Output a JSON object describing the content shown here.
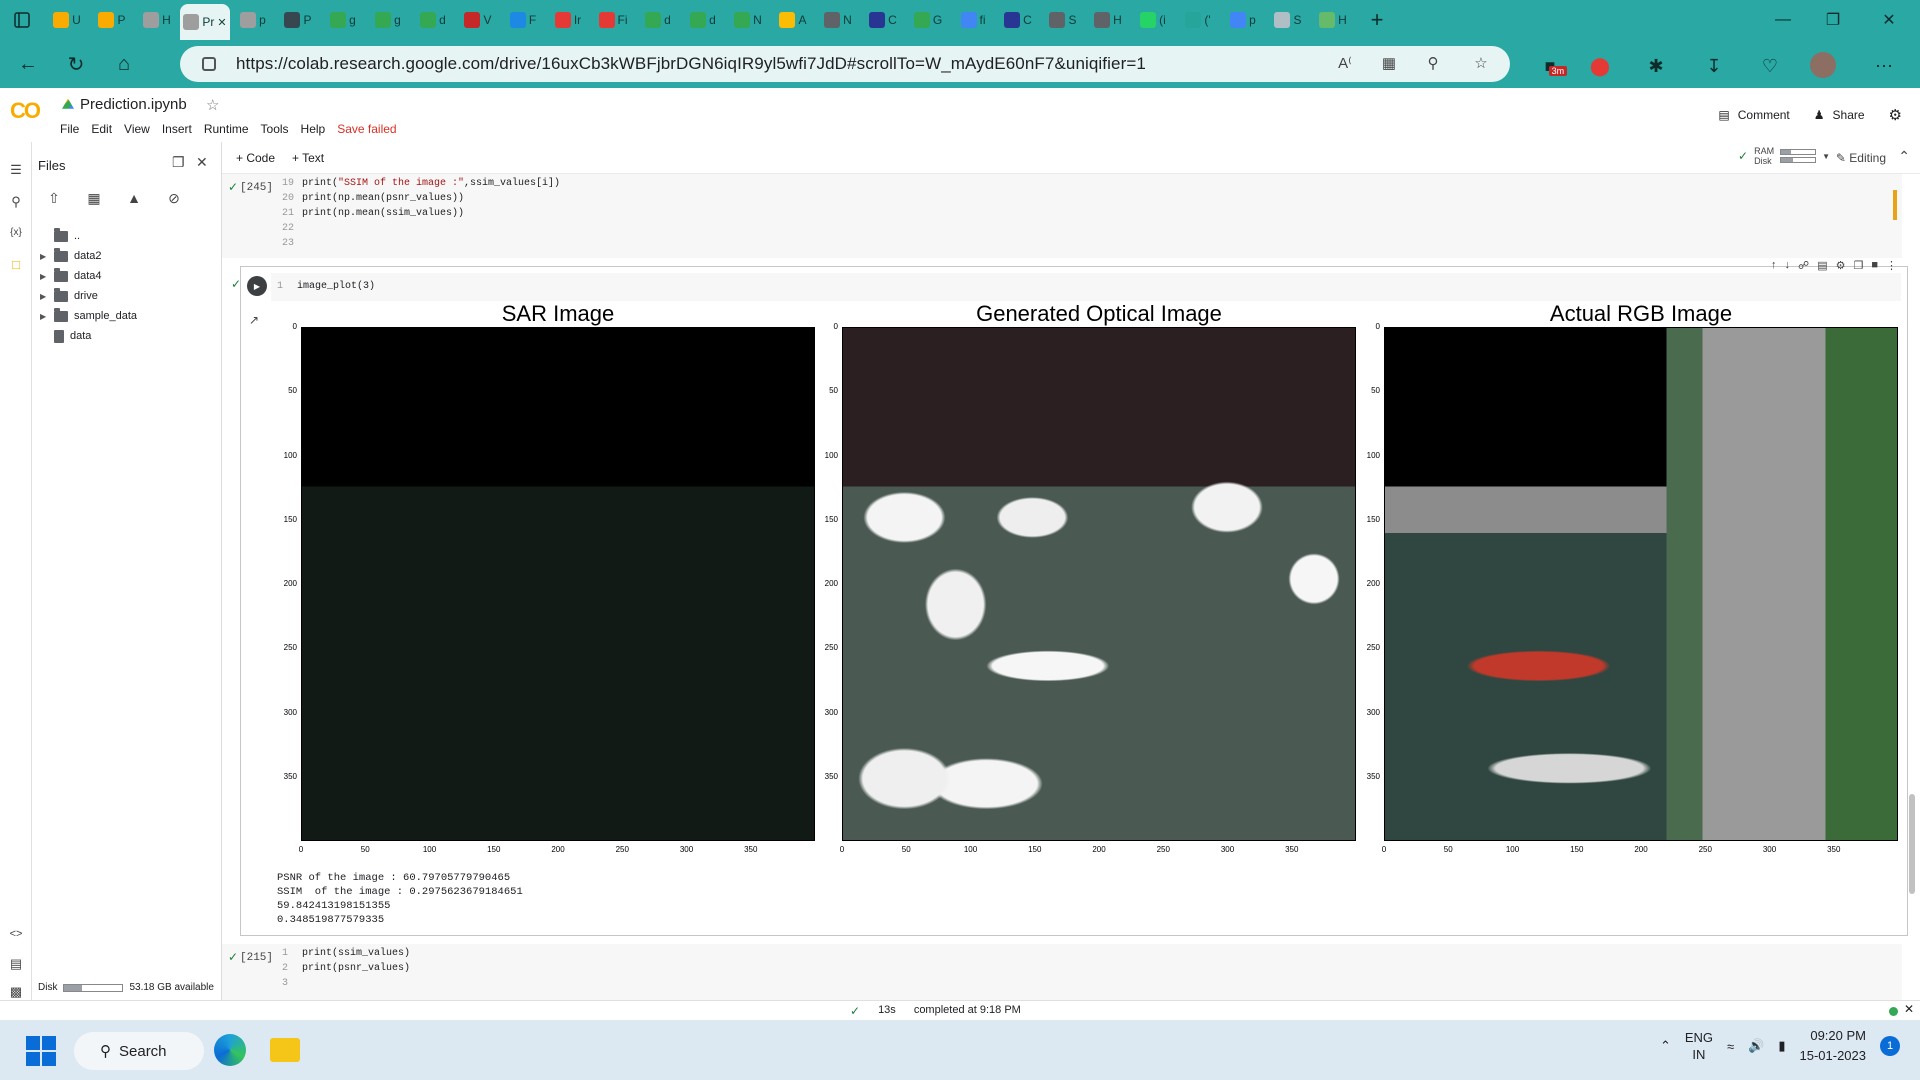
{
  "browser": {
    "tabs": [
      {
        "letter": "U",
        "color": "#f9ab00"
      },
      {
        "letter": "P",
        "color": "#f9ab00"
      },
      {
        "letter": "H",
        "color": "#9e9e9e"
      },
      {
        "letter": "Pr",
        "color": "#9e9e9e",
        "active": true
      },
      {
        "letter": "p",
        "color": "#9e9e9e"
      },
      {
        "letter": "P",
        "color": "#37474f"
      },
      {
        "letter": "g",
        "color": "#34a853"
      },
      {
        "letter": "g",
        "color": "#34a853"
      },
      {
        "letter": "d",
        "color": "#34a853"
      },
      {
        "letter": "V",
        "color": "#c62828"
      },
      {
        "letter": "F",
        "color": "#1e88e5"
      },
      {
        "letter": "Ir",
        "color": "#e53935"
      },
      {
        "letter": "Fi",
        "color": "#e53935"
      },
      {
        "letter": "d",
        "color": "#34a853"
      },
      {
        "letter": "d",
        "color": "#34a853"
      },
      {
        "letter": "N",
        "color": "#34a853"
      },
      {
        "letter": "A",
        "color": "#fbbc04"
      },
      {
        "letter": "N",
        "color": "#5f6368"
      },
      {
        "letter": "C",
        "color": "#283593"
      },
      {
        "letter": "G",
        "color": "#34a853"
      },
      {
        "letter": "fi",
        "color": "#4285f4"
      },
      {
        "letter": "C",
        "color": "#283593"
      },
      {
        "letter": "S",
        "color": "#5f6368"
      },
      {
        "letter": "H",
        "color": "#5f6368"
      },
      {
        "letter": "(i",
        "color": "#25d366"
      },
      {
        "letter": "('",
        "color": "#26a69a"
      },
      {
        "letter": "p",
        "color": "#4285f4"
      },
      {
        "letter": "S",
        "color": "#b0bec5"
      },
      {
        "letter": "H",
        "color": "#66bb6a"
      }
    ],
    "url": "https://colab.research.google.com/drive/16uxCb3kWBFjbrDGN6iqIR9yl5wfi7JdD#scrollTo=W_mAydE60nF7&uniqifier=1",
    "badge": "3m"
  },
  "colab": {
    "notebook_title": "Prediction.ipynb",
    "menu": [
      "File",
      "Edit",
      "View",
      "Insert",
      "Runtime",
      "Tools",
      "Help"
    ],
    "save_status": "Save failed",
    "comment_label": "Comment",
    "share_label": "Share",
    "add_code": "+ Code",
    "add_text": "+ Text",
    "ram_label": "RAM",
    "disk_label": "Disk",
    "ram_usage": 0.3,
    "disk_usage": 0.35,
    "editing_label": "Editing"
  },
  "files_panel": {
    "title": "Files",
    "tree": [
      {
        "name": "..",
        "type": "up"
      },
      {
        "name": "data2",
        "type": "folder"
      },
      {
        "name": "data4",
        "type": "folder"
      },
      {
        "name": "drive",
        "type": "folder"
      },
      {
        "name": "sample_data",
        "type": "folder"
      },
      {
        "name": "data",
        "type": "file"
      }
    ],
    "disk_label": "Disk",
    "disk_usage": 0.3,
    "disk_available": "53.18 GB available"
  },
  "cells": {
    "cell1": {
      "exec_count": "[245]",
      "lines": [
        {
          "n": "19",
          "parts": [
            [
              "print(",
              ""
            ],
            [
              "\"SSIM  of the image :\"",
              "str"
            ],
            [
              ",ssim_values[i])",
              ""
            ]
          ]
        },
        {
          "n": "20",
          "parts": [
            [
              "print(np.mean(psnr_values))",
              ""
            ]
          ]
        },
        {
          "n": "21",
          "parts": [
            [
              "print(np.mean(ssim_values))",
              ""
            ]
          ]
        },
        {
          "n": "22",
          "parts": []
        },
        {
          "n": "23",
          "parts": []
        }
      ]
    },
    "cell2": {
      "line_no": "1",
      "code": "image_plot(3)",
      "output_lines": [
        "PSNR of the image : 60.79705779790465",
        "SSIM  of the image : 0.2975623679184651",
        "59.842413198151355",
        "0.348519877579335"
      ]
    },
    "cell3": {
      "exec_count": "[215]",
      "lines": [
        {
          "n": "1",
          "code": "print(ssim_values)"
        },
        {
          "n": "2",
          "code": "print(psnr_values)"
        },
        {
          "n": "3",
          "code": ""
        }
      ]
    }
  },
  "figure": {
    "panels": [
      {
        "title": "SAR Image",
        "style": "sar"
      },
      {
        "title": "Generated Optical Image",
        "style": "generated"
      },
      {
        "title": "Actual RGB Image",
        "style": "rgb"
      }
    ],
    "x_ticks": [
      "0",
      "50",
      "100",
      "150",
      "200",
      "250",
      "300",
      "350"
    ],
    "y_ticks": [
      "0",
      "50",
      "100",
      "150",
      "200",
      "250",
      "300",
      "350"
    ]
  },
  "statusbar": {
    "duration": "13s",
    "message": "completed at 9:18 PM"
  },
  "taskbar": {
    "search_label": "Search",
    "lang_top": "ENG",
    "lang_bottom": "IN",
    "time": "09:20 PM",
    "date": "15-01-2023",
    "notif_count": "1"
  }
}
